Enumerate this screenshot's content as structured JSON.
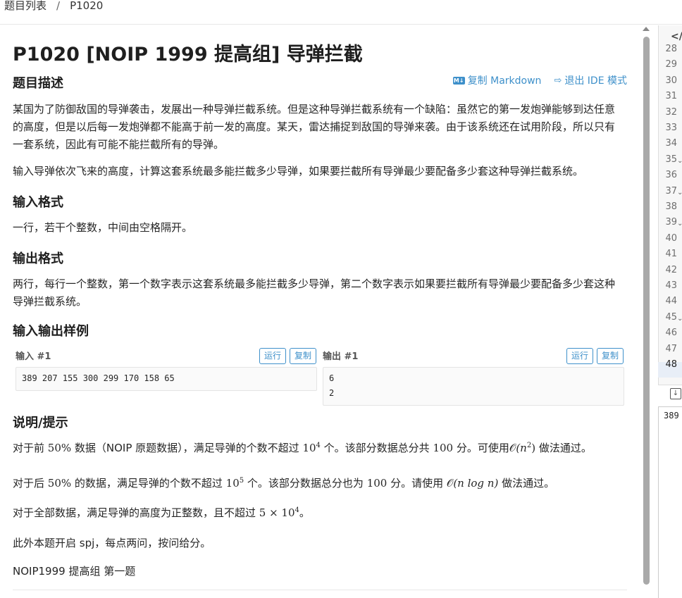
{
  "breadcrumb": {
    "root": "题目列表",
    "separator": "/",
    "current": "P1020"
  },
  "problem": {
    "title": "P1020 [NOIP 1999 提高组] 导弹拦截",
    "copy_markdown": "复制 Markdown",
    "exit_ide": "退出 IDE 模式",
    "md_badge": "M↓",
    "desc_heading": "题目描述",
    "desc_p1": "某国为了防御敌国的导弹袭击，发展出一种导弹拦截系统。但是这种导弹拦截系统有一个缺陷：虽然它的第一发炮弹能够到达任意的高度，但是以后每一发炮弹都不能高于前一发的高度。某天，雷达捕捉到敌国的导弹来袭。由于该系统还在试用阶段，所以只有一套系统，因此有可能不能拦截所有的导弹。",
    "desc_p2": "输入导弹依次飞来的高度，计算这套系统最多能拦截多少导弹，如果要拦截所有导弹最少要配备多少套这种导弹拦截系统。",
    "input_heading": "输入格式",
    "input_text": "一行，若干个整数，中间由空格隔开。",
    "output_heading": "输出格式",
    "output_text": "两行，每行一个整数，第一个数字表示这套系统最多能拦截多少导弹，第二个数字表示如果要拦截所有导弹最少要配备多少套这种导弹拦截系统。",
    "samples_heading": "输入输出样例",
    "sample_input_label": "输入 #1",
    "sample_output_label": "输出 #1",
    "run_label": "运行",
    "copy_label": "复制",
    "sample_input": "389 207 155 300 299 170 158 65",
    "sample_output": "6\n2",
    "hint_heading": "说明/提示",
    "hint1_a": "对于前 ",
    "hint1_pct": "50%",
    "hint1_b": " 数据（NOIP 原题数据），满足导弹的个数不超过 ",
    "hint1_n": "10",
    "hint1_exp": "4",
    "hint1_c": " 个。该部分数据总分共 ",
    "hint1_score": "100",
    "hint1_d": " 分。可使用",
    "hint1_o": "𝒪",
    "hint1_complex": "(n",
    "hint1_cexp": "2",
    "hint1_cclose": ")",
    "hint1_e": " 做法通过。",
    "hint2_a": "对于后 ",
    "hint2_pct": "50%",
    "hint2_b": " 的数据，满足导弹的个数不超过 ",
    "hint2_n": "10",
    "hint2_exp": "5",
    "hint2_c": " 个。该部分数据总分也为 ",
    "hint2_score": "100",
    "hint2_d": " 分。请使用 ",
    "hint2_o": "𝒪",
    "hint2_complex": "(n log n)",
    "hint2_e": " 做法通过。",
    "hint3_a": "对于全部数据，满足导弹的高度为正整数，且不超过 ",
    "hint3_math": "5 × 10",
    "hint3_exp": "4",
    "hint3_b": "。",
    "hint4": "此外本题开启 spj，每点两问，按问给分。",
    "hint5": "NOIP1999 提高组 第一题"
  },
  "editor": {
    "code_icon": "</>",
    "line_numbers": [
      "28",
      "29",
      "30",
      "31",
      "32",
      "33",
      "34",
      "35",
      "36",
      "37",
      "38",
      "39",
      "40",
      "41",
      "42",
      "43",
      "44",
      "45",
      "46",
      "47",
      "48"
    ],
    "fold_lines": [
      "35",
      "37",
      "39",
      "45"
    ],
    "active_line": "48",
    "input_value": "389"
  }
}
